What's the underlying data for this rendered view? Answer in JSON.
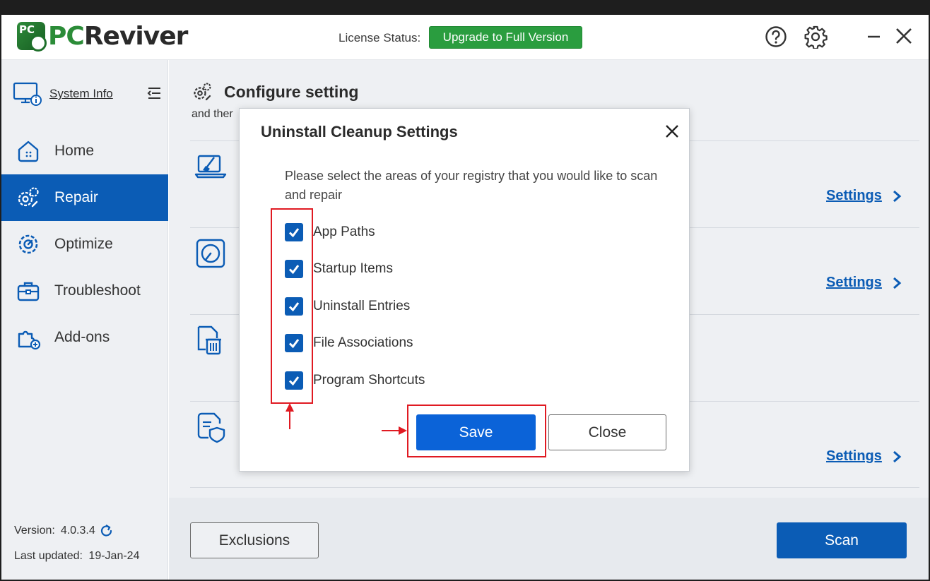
{
  "app": {
    "logo_pc": "PC",
    "logo_rev": "Reviver",
    "logo_badge": "PC"
  },
  "header": {
    "license_label": "License Status:",
    "upgrade_label": "Upgrade to Full Version"
  },
  "sidebar": {
    "system_info": "System Info",
    "items": [
      {
        "label": "Home",
        "icon": "home-icon"
      },
      {
        "label": "Repair",
        "icon": "repair-gears-icon",
        "active": true
      },
      {
        "label": "Optimize",
        "icon": "optimize-gear-icon"
      },
      {
        "label": "Troubleshoot",
        "icon": "toolbox-icon"
      },
      {
        "label": "Add-ons",
        "icon": "puzzle-icon"
      }
    ],
    "version_label": "Version:",
    "version_value": "4.0.3.4",
    "updated_label": "Last updated:",
    "updated_value": "19-Jan-24"
  },
  "main": {
    "title": "Configure setting",
    "subtitle": "and ther",
    "rows": [
      {
        "icon": "laptop-cleanup-icon",
        "settings_label": "Settings"
      },
      {
        "icon": "disk-icon",
        "settings_label": "Settings"
      },
      {
        "icon": "uninstall-file-icon"
      },
      {
        "icon": "shield-document-icon",
        "settings_label": "Settings"
      }
    ],
    "exclusions_label": "Exclusions",
    "scan_label": "Scan"
  },
  "dialog": {
    "title": "Uninstall Cleanup Settings",
    "description": "Please select the areas of your registry that you would like to scan and repair",
    "options": [
      {
        "label": "App Paths",
        "checked": true
      },
      {
        "label": "Startup Items",
        "checked": true
      },
      {
        "label": "Uninstall Entries",
        "checked": true
      },
      {
        "label": "File Associations",
        "checked": true
      },
      {
        "label": "Program Shortcuts",
        "checked": true
      }
    ],
    "save_label": "Save",
    "close_label": "Close"
  },
  "colors": {
    "accent": "#0b5cb5",
    "upgrade_green": "#2a9d3f",
    "annotation_red": "#e01a22"
  }
}
